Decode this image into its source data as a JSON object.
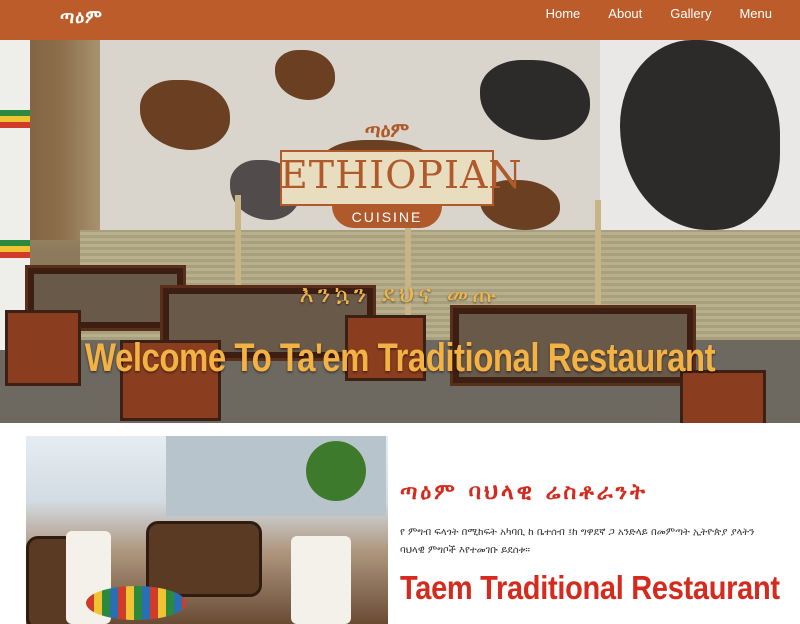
{
  "nav": {
    "brand": "ጣዕም",
    "items": [
      {
        "label": "Home"
      },
      {
        "label": "About"
      },
      {
        "label": "Gallery"
      },
      {
        "label": "Menu"
      }
    ]
  },
  "hero": {
    "sign_amharic": "ጣዕም",
    "sign_main": "ETHIOPIAN",
    "sign_sub": "CUISINE",
    "greeting_amharic": "እንኳን ደህና መጡ",
    "welcome": "Welcome To Ta'em Traditional Restaurant"
  },
  "about": {
    "title_amharic": "ጣዕም ባህላዊ ሬስቶራንት",
    "text": "የ ምግብ ፍላጎት በሚከፍት አካባቢ ከ ቤተሰብ ፤ከ ግዋደኛ ጋ አንድላይ በመምጣት ኢትዮጵያ ያላትን ባህላዊ ምግቦች እየተመገቡ ይደሰቱ።",
    "heading": "Taem Traditional Restaurant"
  },
  "colors": {
    "nav_bg": "#bb5c2a",
    "hero_text": "#f4b244",
    "accent_red": "#d52b1e"
  }
}
